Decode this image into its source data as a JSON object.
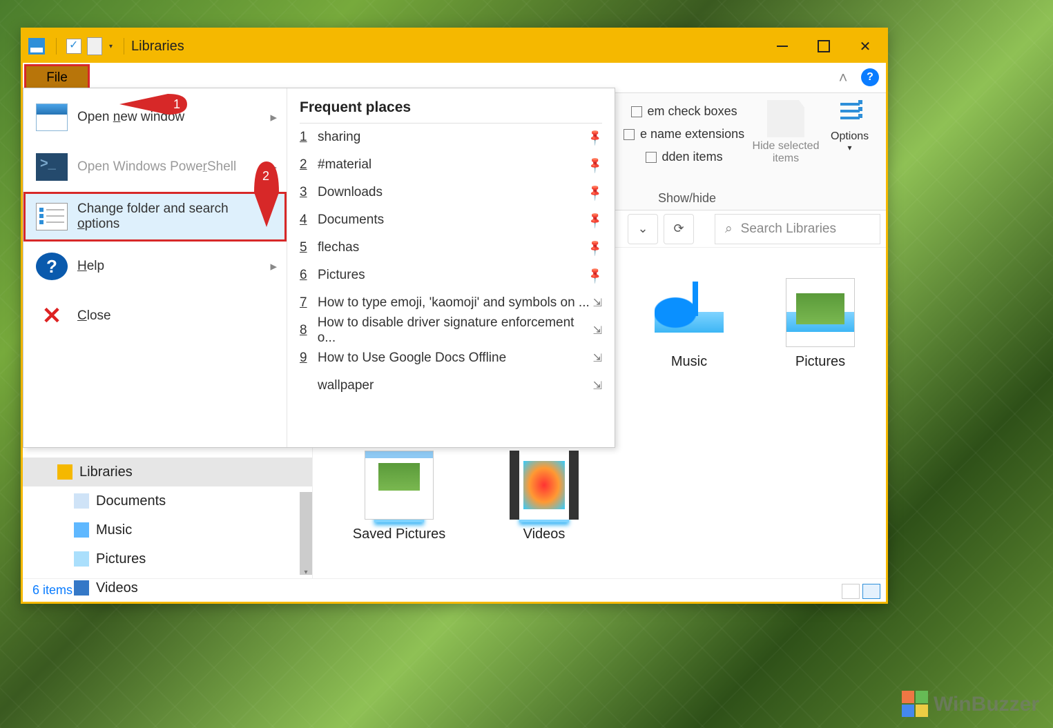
{
  "titlebar": {
    "title": "Libraries"
  },
  "ribbon": {
    "file_tab": "File",
    "check_boxes_label": "em check boxes",
    "ext_label": "e name extensions",
    "hidden_label": "dden items",
    "hide_selected": "Hide selected items",
    "options": "Options",
    "group_label": "Show/hide"
  },
  "nav": {
    "refresh": "⟳",
    "down": "⌄"
  },
  "search": {
    "placeholder": "Search Libraries"
  },
  "sidebar": {
    "items": [
      {
        "label": "Libraries"
      },
      {
        "label": "Documents"
      },
      {
        "label": "Music"
      },
      {
        "label": "Pictures"
      },
      {
        "label": "Videos"
      }
    ]
  },
  "content": {
    "music": "Music",
    "pictures": "Pictures",
    "saved": "Saved Pictures",
    "videos": "Videos"
  },
  "status": {
    "text": "6 items"
  },
  "file_menu": {
    "open_new_pre": "Open ",
    "open_new_u": "n",
    "open_new_post": "ew window",
    "powershell_pre": "Open Windows Powe",
    "powershell_u": "r",
    "powershell_post": "Shell",
    "change_pre": "Change folder and search ",
    "change_u": "o",
    "change_post": "ptions",
    "help_u": "H",
    "help_post": "elp",
    "close_u": "C",
    "close_post": "lose",
    "frequent_title": "Frequent places",
    "places": [
      {
        "n": "1",
        "label": "sharing",
        "pinned": true
      },
      {
        "n": "2",
        "label": "#material",
        "pinned": true
      },
      {
        "n": "3",
        "label": "Downloads",
        "pinned": true
      },
      {
        "n": "4",
        "label": "Documents",
        "pinned": true
      },
      {
        "n": "5",
        "label": "flechas",
        "pinned": true
      },
      {
        "n": "6",
        "label": "Pictures",
        "pinned": true
      },
      {
        "n": "7",
        "label": "How to type emoji, 'kaomoji' and symbols on ...",
        "pinned": false
      },
      {
        "n": "8",
        "label": "How to disable driver signature enforcement o...",
        "pinned": false
      },
      {
        "n": "9",
        "label": "How to Use Google Docs Offline",
        "pinned": false
      },
      {
        "n": "",
        "label": "wallpaper",
        "pinned": false
      }
    ]
  },
  "annotations": {
    "one": "1",
    "two": "2"
  },
  "watermark": "WinBuzzer"
}
